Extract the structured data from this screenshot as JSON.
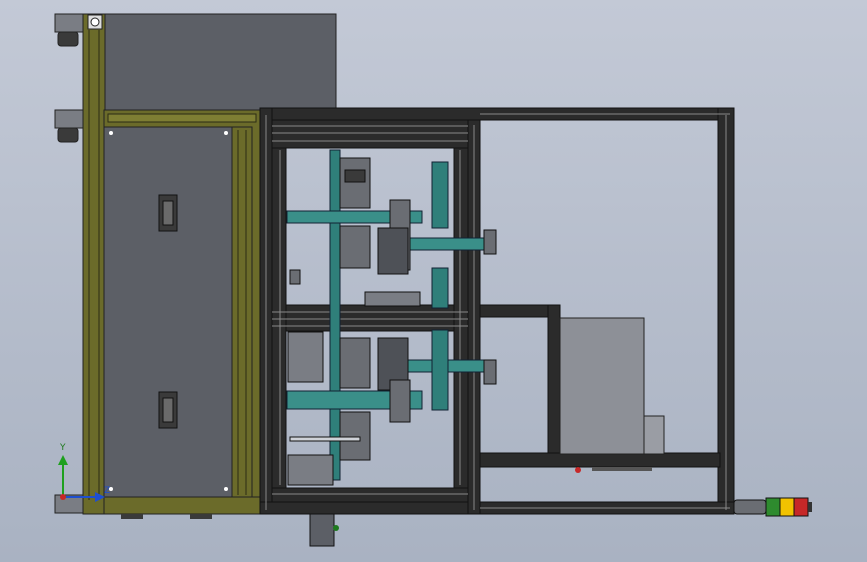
{
  "viewport": {
    "triad": {
      "y_label": "Y",
      "z_label": "Z"
    },
    "colors": {
      "background_top": "#c3c9d6",
      "background_bottom": "#a9b2c2",
      "olive_frame": "#6b6b2a",
      "dark_frame": "#2b2b2b",
      "panel_gray": "#5c5f66",
      "enclosure_light": "#8d9097",
      "teal_part": "#2f7f7a",
      "teal_cylinder": "#3a8f89",
      "stack_light_red": "#c62828",
      "stack_light_yellow": "#f2c200",
      "stack_light_green": "#2e8b2e"
    }
  }
}
